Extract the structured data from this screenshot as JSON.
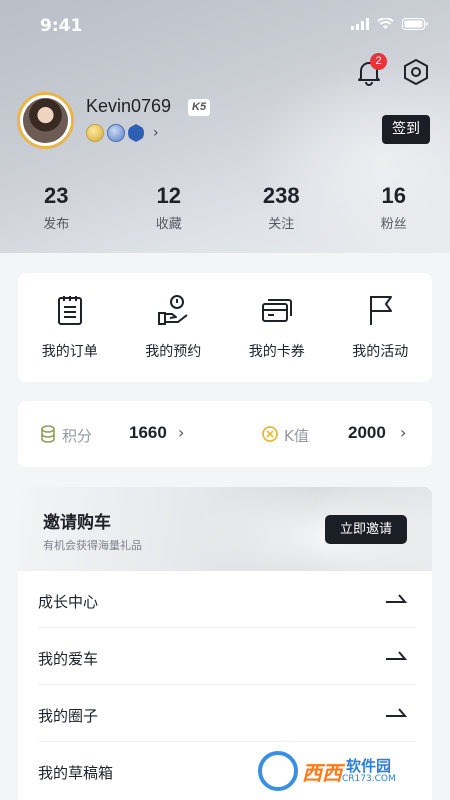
{
  "status_bar": {
    "time": "9:41"
  },
  "header": {
    "notification_count": "2",
    "username": "Kevin0769",
    "level_badge": "K5",
    "signin_label": "签到"
  },
  "stats": [
    {
      "value": "23",
      "label": "发布"
    },
    {
      "value": "12",
      "label": "收藏"
    },
    {
      "value": "238",
      "label": "关注"
    },
    {
      "value": "16",
      "label": "粉丝"
    }
  ],
  "quick_actions": [
    {
      "label": "我的订单",
      "icon": "order-list-icon"
    },
    {
      "label": "我的预约",
      "icon": "appointment-hand-icon"
    },
    {
      "label": "我的卡券",
      "icon": "coupon-cards-icon"
    },
    {
      "label": "我的活动",
      "icon": "flag-icon"
    }
  ],
  "points": {
    "points_label": "积分",
    "points_value": "1660",
    "k_label": "K值",
    "k_value": "2000",
    "chevron": "›"
  },
  "invite": {
    "title": "邀请购车",
    "subtitle": "有机会获得海量礼品",
    "button": "立即邀请"
  },
  "menu": [
    {
      "label": "成长中心"
    },
    {
      "label": "我的爱车"
    },
    {
      "label": "我的圈子"
    },
    {
      "label": "我的草稿箱"
    }
  ],
  "watermark": {
    "text": "西西",
    "brand": "软件园",
    "site": "CR173.COM"
  },
  "colors": {
    "accent_dark": "#1b1e24",
    "badge_red": "#e8323c",
    "avatar_ring": "#e9b54a"
  }
}
